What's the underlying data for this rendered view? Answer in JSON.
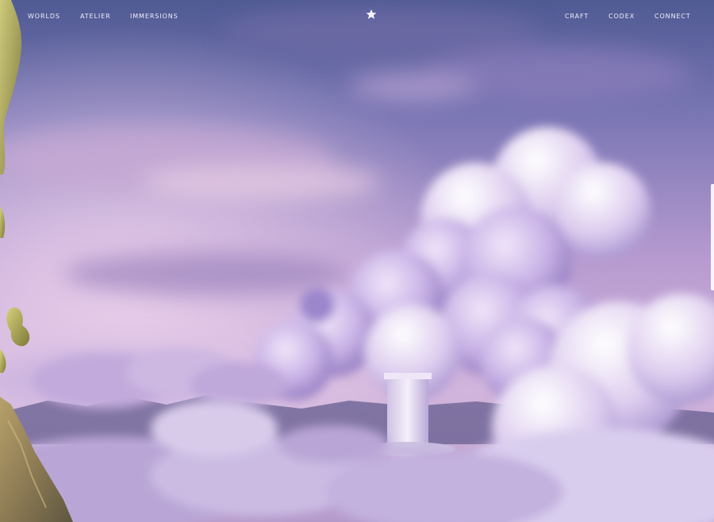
{
  "nav": {
    "left": [
      {
        "label": "WORLDS"
      },
      {
        "label": "ATELIER"
      },
      {
        "label": "IMMERSIONS"
      }
    ],
    "logo_icon": "star-icon",
    "right": [
      {
        "label": "CRAFT"
      },
      {
        "label": "CODEX"
      },
      {
        "label": "CONNECT"
      }
    ]
  },
  "colors": {
    "sky_top": "#55609a",
    "sky_mid": "#9b86c4",
    "sky_low": "#d8b7dc",
    "cloud": "#d9c7ec",
    "cloud_shadow": "#8f78be",
    "nav_text": "#f2eefc",
    "vine": "#b4b25a"
  }
}
